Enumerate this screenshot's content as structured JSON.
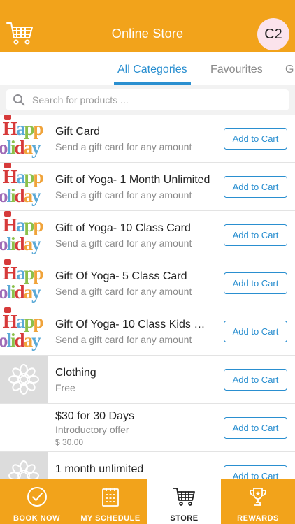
{
  "header": {
    "title": "Online Store",
    "avatar_text": "C2",
    "cart_icon": "cart-icon"
  },
  "tabs": [
    {
      "label": "All Categories",
      "active": true
    },
    {
      "label": "Favourites",
      "active": false
    },
    {
      "label": "G",
      "active": false
    }
  ],
  "search": {
    "placeholder": "Search for products ...",
    "icon": "search-icon"
  },
  "products": [
    {
      "name": "Gift Card",
      "subtitle": "Send a gift card for any amount",
      "price": "",
      "thumb": "holiday",
      "button": "Add to Cart"
    },
    {
      "name": "Gift of Yoga- 1 Month Unlimited",
      "subtitle": "Send a gift card for any amount",
      "price": "",
      "thumb": "holiday",
      "button": "Add to Cart"
    },
    {
      "name": "Gift of Yoga- 10 Class Card",
      "subtitle": "Send a gift card for any amount",
      "price": "",
      "thumb": "holiday",
      "button": "Add to Cart"
    },
    {
      "name": "Gift Of Yoga- 5 Class Card",
      "subtitle": "Send a gift card for any amount",
      "price": "",
      "thumb": "holiday",
      "button": "Add to Cart"
    },
    {
      "name": "Gift Of Yoga- 10 Class Kids …",
      "subtitle": "Send a gift card for any amount",
      "price": "",
      "thumb": "holiday",
      "button": "Add to Cart"
    },
    {
      "name": "Clothing",
      "subtitle": "Free",
      "price": "",
      "thumb": "flower",
      "button": "Add to Cart"
    },
    {
      "name": "$30 for 30 Days",
      "subtitle": "Introductory offer",
      "price": "$ 30.00",
      "thumb": "none",
      "button": "Add to Cart"
    },
    {
      "name": "1 month unlimited",
      "subtitle": "",
      "price": "",
      "thumb": "flower",
      "button": "Add to Cart"
    }
  ],
  "thumb_text": {
    "line1": "Happ",
    "line2": "oliday"
  },
  "bottom_nav": [
    {
      "label": "BOOK NOW",
      "icon": "checkmark-circle-icon",
      "active": false
    },
    {
      "label": "MY SCHEDULE",
      "icon": "calendar-icon",
      "active": false
    },
    {
      "label": "STORE",
      "icon": "cart-icon",
      "active": true
    },
    {
      "label": "REWARDS",
      "icon": "trophy-icon",
      "active": false
    }
  ],
  "colors": {
    "brand_orange": "#f2a31b",
    "accent_blue": "#2a8fd0",
    "avatar_bg": "#fbe3ec"
  }
}
